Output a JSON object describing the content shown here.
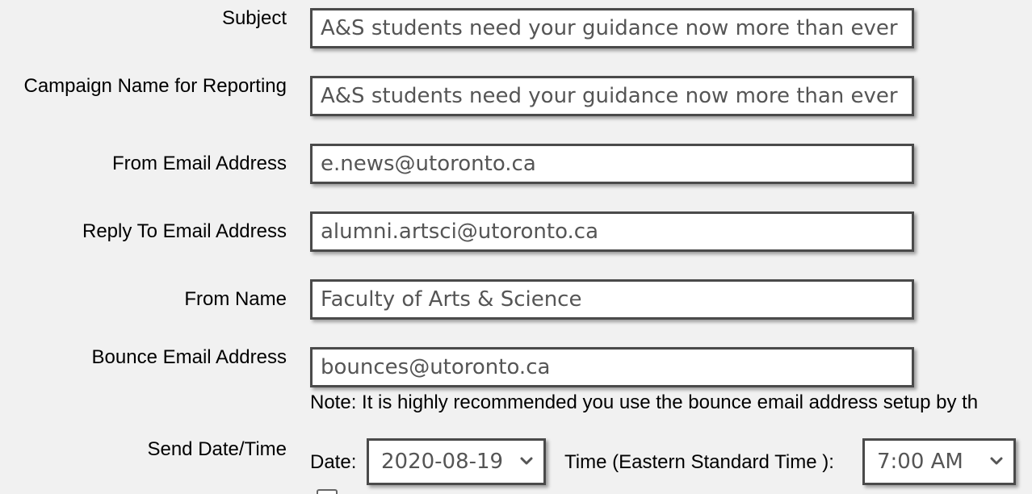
{
  "form": {
    "subject": {
      "label": "Subject",
      "value": "A&S students need your guidance now more than ever"
    },
    "campaign_name": {
      "label": "Campaign Name for Reporting",
      "value": "A&S students need your guidance now more than ever"
    },
    "from_email": {
      "label": "From Email Address",
      "value": "e.news@utoronto.ca"
    },
    "reply_to_email": {
      "label": "Reply To Email Address",
      "value": "alumni.artsci@utoronto.ca"
    },
    "from_name": {
      "label": "From Name",
      "value": "Faculty of Arts & Science"
    },
    "bounce_email": {
      "label": "Bounce Email Address",
      "value": "bounces@utoronto.ca",
      "note": "Note: It is highly recommended you use the bounce email address setup by th"
    },
    "send_datetime": {
      "label": "Send Date/Time",
      "date_label": "Date:",
      "date_value": "2020-08-19",
      "time_label": "Time (Eastern Standard Time ):",
      "time_value": "7:00 AM"
    }
  },
  "icons": {
    "dropdown": "chevron-down-icon"
  }
}
